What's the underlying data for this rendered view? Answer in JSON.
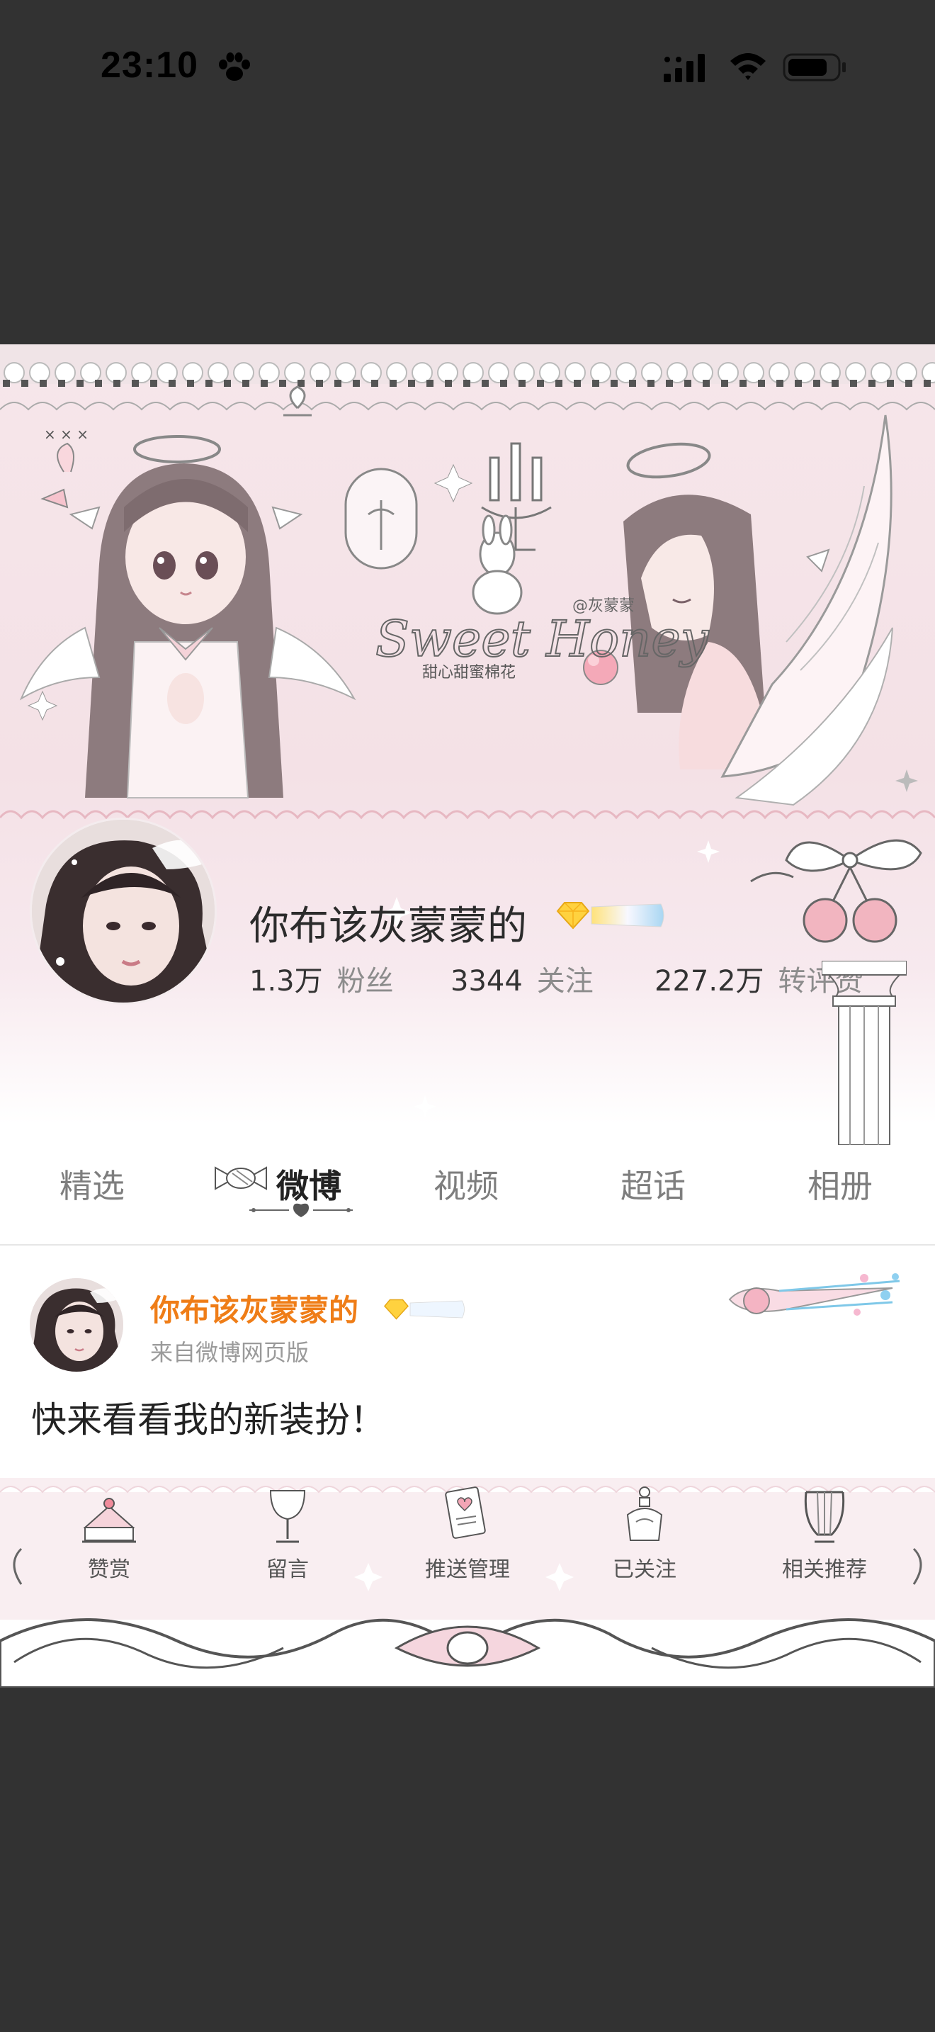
{
  "status_bar": {
    "time": "23:10",
    "icons": [
      "paw-icon",
      "cellular-signal-icon",
      "wifi-icon",
      "battery-icon"
    ]
  },
  "profile": {
    "name": "你布该灰蒙蒙的",
    "badge_icon": "diamond-vip-badge-icon",
    "stats": [
      {
        "value": "1.3万",
        "label": "粉丝"
      },
      {
        "value": "3344",
        "label": "关注"
      },
      {
        "value": "227.2万",
        "label": "转评赞"
      }
    ]
  },
  "banner": {
    "watermark": "@灰蒙蒙",
    "tagline": "甜心甜蜜棉花",
    "script_title": "Sweet Honey"
  },
  "tabs": [
    {
      "label": "精选",
      "active": false
    },
    {
      "label": "微博",
      "active": true
    },
    {
      "label": "视频",
      "active": false
    },
    {
      "label": "超话",
      "active": false
    },
    {
      "label": "相册",
      "active": false
    }
  ],
  "post": {
    "author": "你布该灰蒙蒙的",
    "source": "来自微博网页版",
    "text": "快来看看我的新装扮！"
  },
  "toolbar": [
    {
      "label": "赞赏",
      "icon": "cake-icon"
    },
    {
      "label": "留言",
      "icon": "goblet-icon"
    },
    {
      "label": "推送管理",
      "icon": "love-card-icon"
    },
    {
      "label": "已关注",
      "icon": "perfume-bottle-icon"
    },
    {
      "label": "相关推荐",
      "icon": "lyre-icon"
    }
  ],
  "colors": {
    "backdrop": "#323232",
    "author_orange": "#ef7d17",
    "banner_pink": "#f4e1e6"
  }
}
